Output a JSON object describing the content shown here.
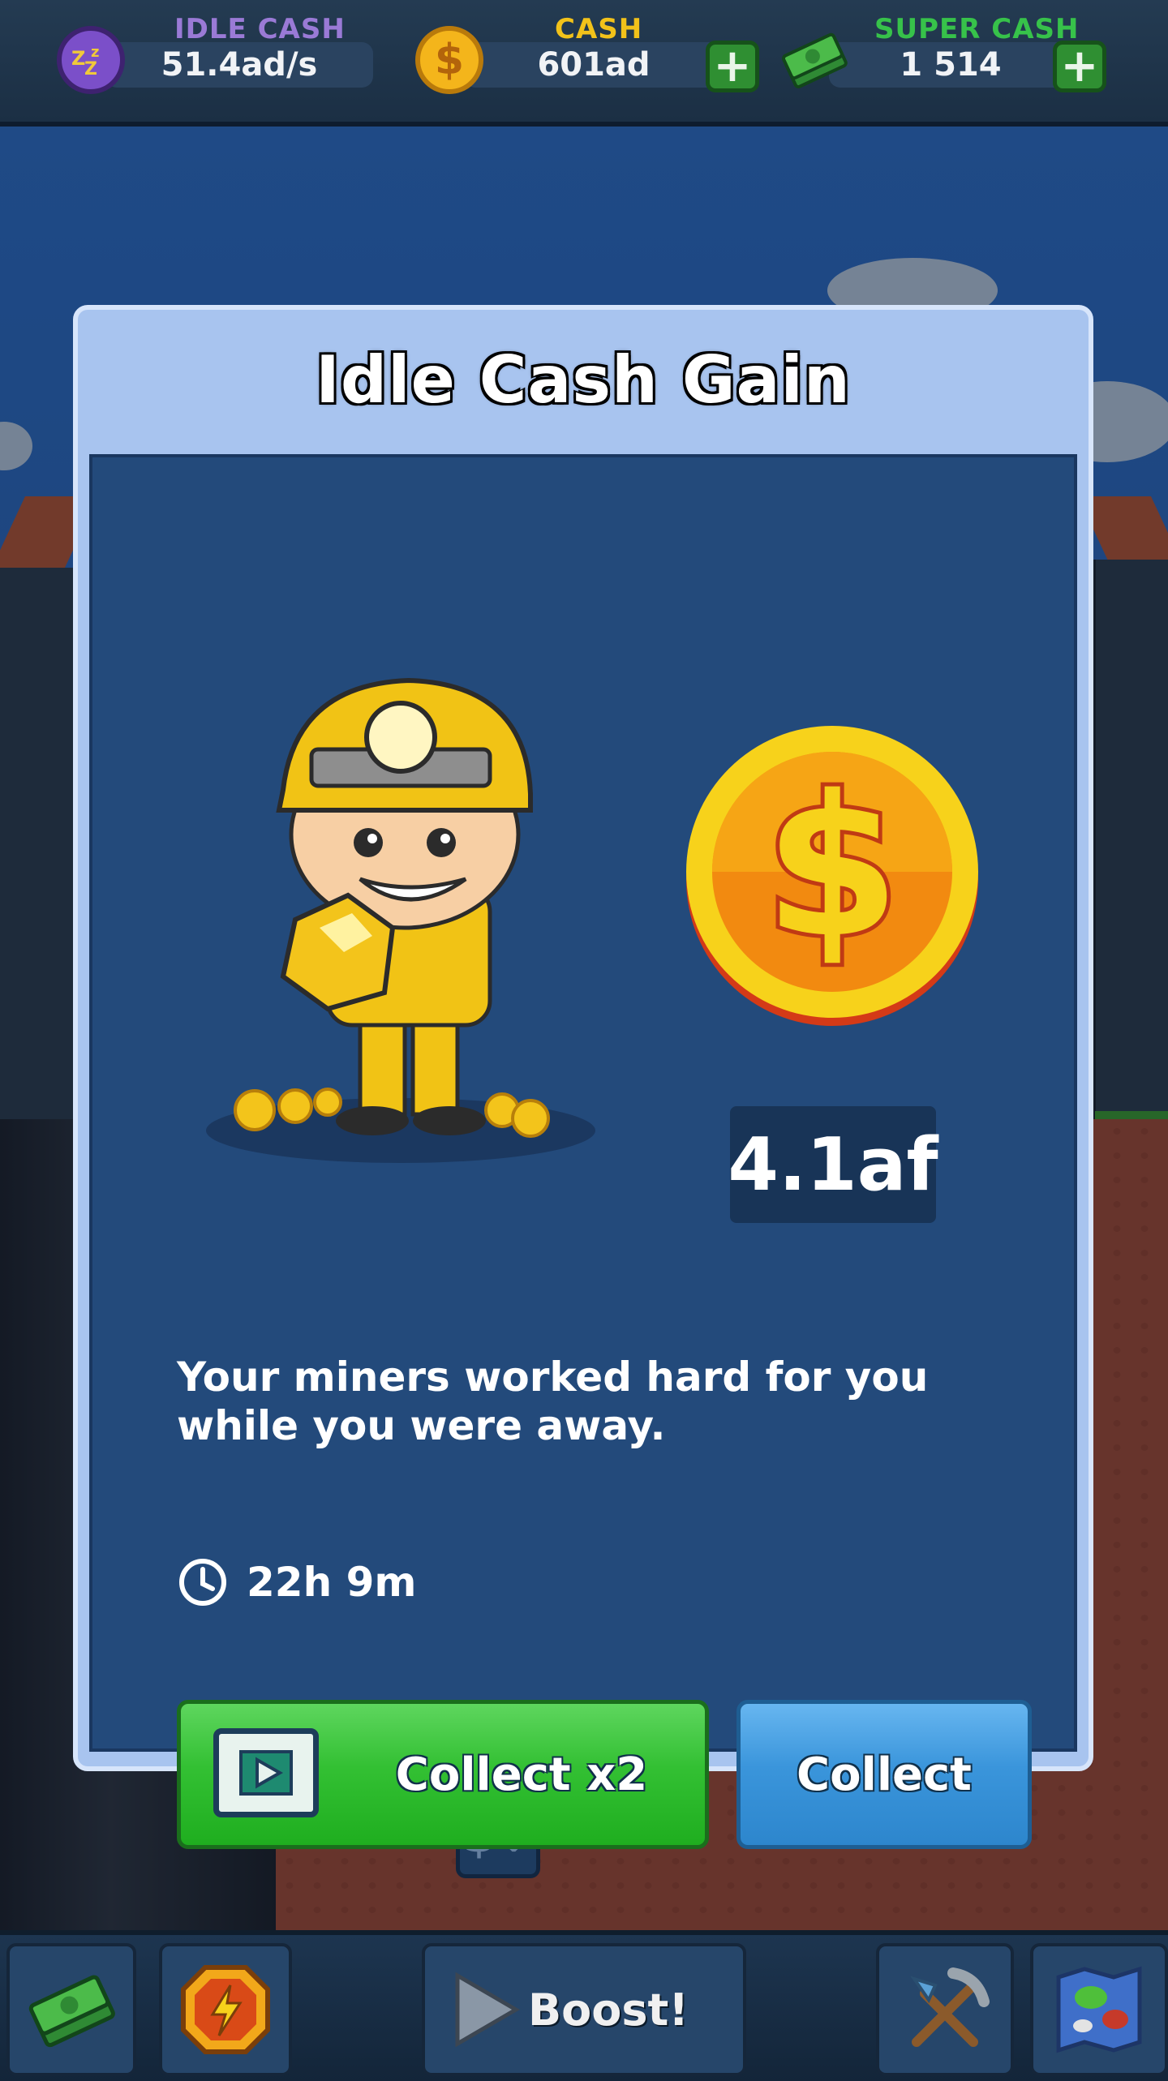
{
  "top_bar": {
    "idle_cash": {
      "label": "IDLE CASH",
      "value": "51.4ad/s",
      "icon": "zzz-sleep-coin-icon"
    },
    "cash": {
      "label": "CASH",
      "value": "601ad",
      "icon": "dollar-coin-icon"
    },
    "super_cash": {
      "label": "SUPER CASH",
      "value": "1 514",
      "icon": "money-stack-icon"
    },
    "add_symbol": "+"
  },
  "modal": {
    "title": "Idle Cash Gain",
    "amount": "4.1af",
    "message": "Your miners worked hard for you while you were away.",
    "time_away": "22h 9m",
    "buttons": {
      "collect_double": "Collect x2",
      "collect": "Collect"
    }
  },
  "bottom_bar": {
    "boost_label": "Boost!",
    "items": [
      "money-stack-icon",
      "lightning-badge-icon",
      "boost-play-icon",
      "pickaxe-shovel-icon",
      "world-map-icon"
    ]
  },
  "background": {
    "sign_label": "$↓"
  },
  "colors": {
    "idle_label": "#9a7ad6",
    "cash_label": "#f2c21a",
    "super_label": "#37c24a",
    "green_button": "#2fbb2f",
    "blue_button": "#3a95db",
    "modal_frame": "#a8c4ef",
    "modal_body": "#234a7b"
  }
}
